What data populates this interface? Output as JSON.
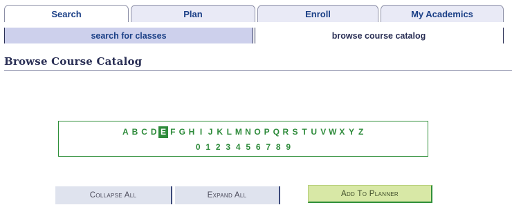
{
  "tabs": [
    {
      "label": "Search",
      "active": true
    },
    {
      "label": "Plan",
      "active": false
    },
    {
      "label": "Enroll",
      "active": false
    },
    {
      "label": "My Academics",
      "active": false
    }
  ],
  "subtabs": [
    {
      "label": "search for classes",
      "active": false
    },
    {
      "label": "browse course catalog",
      "active": true
    }
  ],
  "page_title": "Browse Course Catalog",
  "letters": [
    "A",
    "B",
    "C",
    "D",
    "E",
    "F",
    "G",
    "H",
    "I",
    "J",
    "K",
    "L",
    "M",
    "N",
    "O",
    "P",
    "Q",
    "R",
    "S",
    "T",
    "U",
    "V",
    "W",
    "X",
    "Y",
    "Z"
  ],
  "selected_letter": "E",
  "digits": [
    "0",
    "1",
    "2",
    "3",
    "4",
    "5",
    "6",
    "7",
    "8",
    "9"
  ],
  "buttons": {
    "collapse_all": "Collapse All",
    "expand_all": "Expand All",
    "add_to_planner": "Add To Planner"
  },
  "colors": {
    "link_green": "#2e8b3b",
    "tab_text": "#1a3f86",
    "title_text": "#2a2f55"
  }
}
